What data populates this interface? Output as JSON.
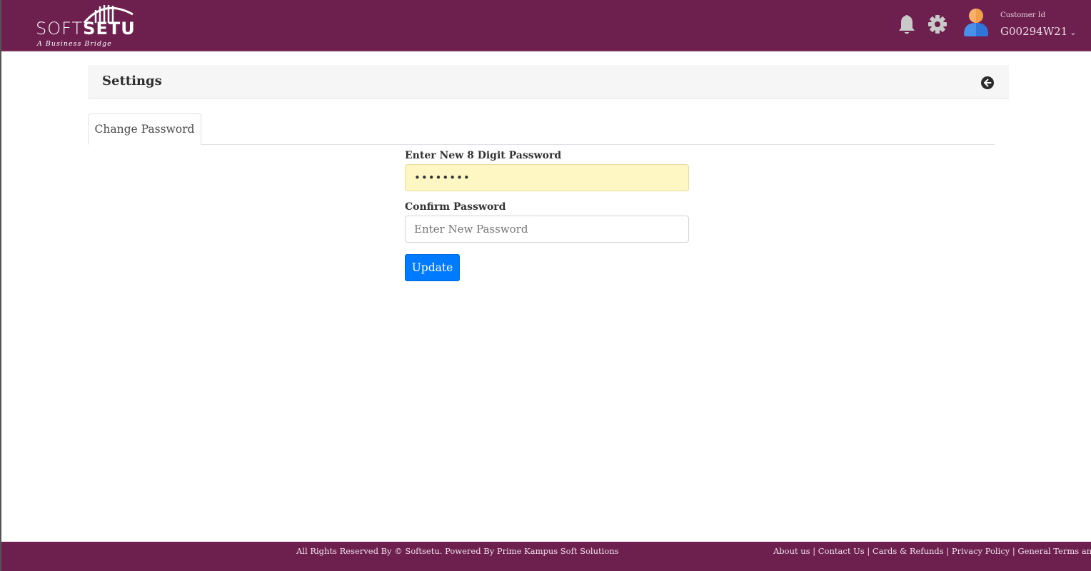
{
  "header": {
    "logo": {
      "word_light": "SOFT",
      "word_bold": "SETU",
      "tagline": "A Business Bridge"
    },
    "icons": [
      "bell-icon",
      "gear-icon",
      "user-avatar-icon"
    ],
    "customer_label": "Customer Id",
    "customer_id": "G00294W21",
    "chevron": "⌄"
  },
  "settings": {
    "title": "Settings",
    "back_icon": "arrow-left-circle-icon"
  },
  "tabs": [
    {
      "label": "Change Password",
      "active": true
    }
  ],
  "form": {
    "new_password_label": "Enter New 8 Digit Password",
    "new_password_value": "••••••••",
    "confirm_password_label": "Confirm Password",
    "confirm_password_placeholder": "Enter New Password",
    "confirm_password_value": "",
    "submit_label": "Update"
  },
  "footer": {
    "copyright": "All Rights Reserved By © Softsetu. Powered By Prime Kampus Soft Solutions",
    "links": [
      "About us",
      "Contact Us",
      "Cards & Refunds",
      "Privacy Policy",
      "General Terms and Conditions"
    ],
    "separator": " | "
  },
  "colors": {
    "brand": "#6d1f4e",
    "primary_button": "#007bff",
    "autofill": "#fef7c3"
  }
}
